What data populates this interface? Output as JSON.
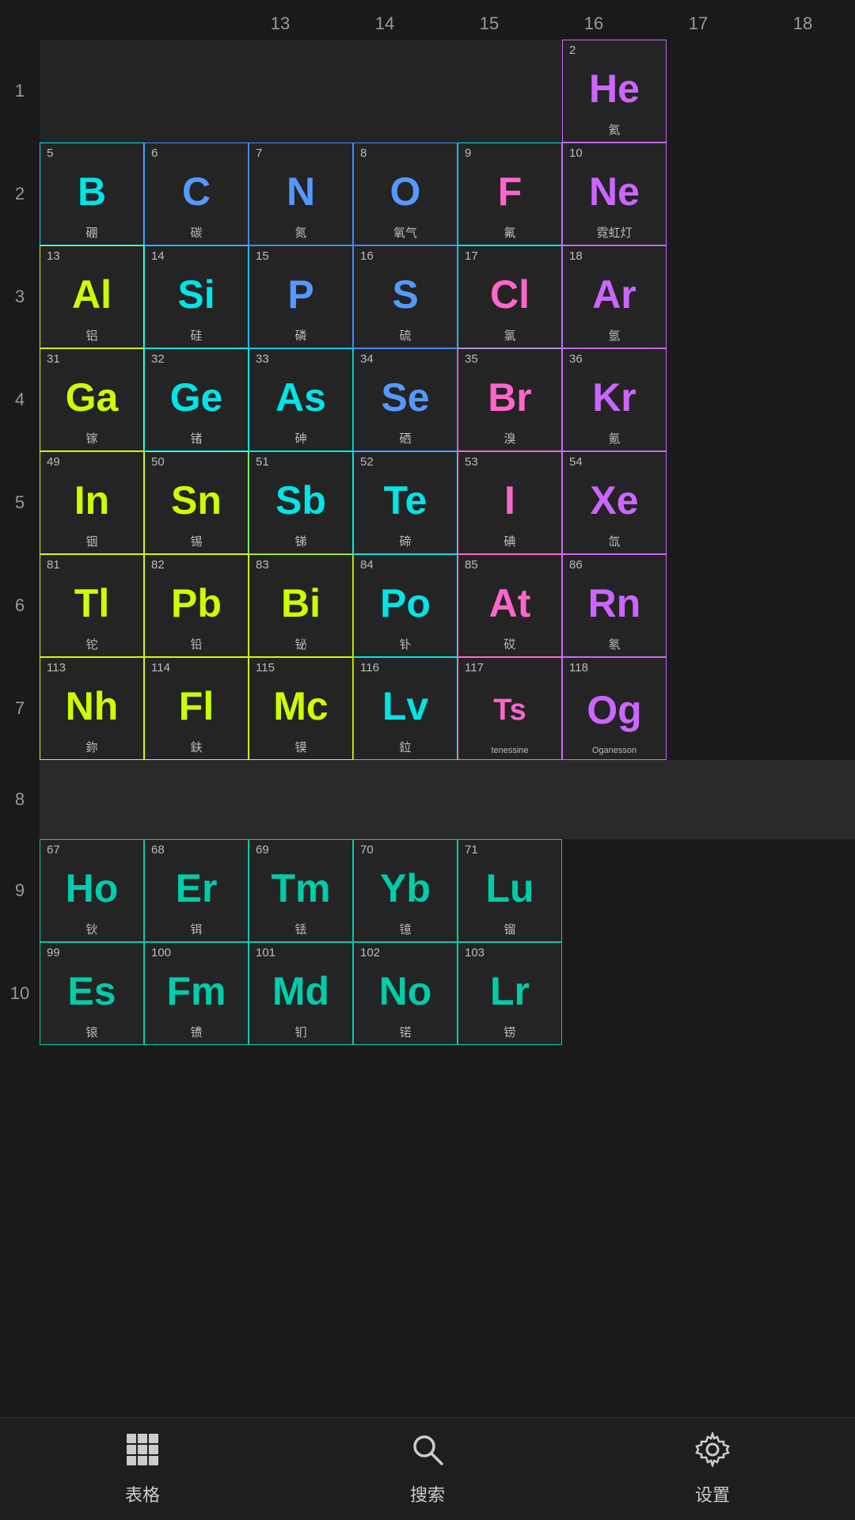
{
  "colHeaders": [
    "13",
    "14",
    "15",
    "16",
    "17",
    "18"
  ],
  "rowLabels": [
    "1",
    "2",
    "3",
    "4",
    "5",
    "6",
    "7",
    "8",
    "9",
    "10"
  ],
  "rows": [
    {
      "rowNum": "1",
      "cells": [
        {
          "num": "",
          "sym": "",
          "name": "",
          "color": "",
          "border": "",
          "empty": true
        },
        {
          "num": "",
          "sym": "",
          "name": "",
          "color": "",
          "border": "",
          "empty": true
        },
        {
          "num": "",
          "sym": "",
          "name": "",
          "color": "",
          "border": "",
          "empty": true
        },
        {
          "num": "",
          "sym": "",
          "name": "",
          "color": "",
          "border": "",
          "empty": true
        },
        {
          "num": "",
          "sym": "",
          "name": "",
          "color": "",
          "border": "",
          "empty": true
        },
        {
          "num": "2",
          "sym": "He",
          "name": "氦",
          "color": "s-purple",
          "border": "b-purple",
          "empty": false
        }
      ]
    },
    {
      "rowNum": "2",
      "cells": [
        {
          "num": "5",
          "sym": "B",
          "name": "硼",
          "color": "s-cyan",
          "border": "b-cyan",
          "empty": false
        },
        {
          "num": "6",
          "sym": "C",
          "name": "碳",
          "color": "s-blue",
          "border": "b-blue",
          "empty": false
        },
        {
          "num": "7",
          "sym": "N",
          "name": "氮",
          "color": "s-blue",
          "border": "b-blue",
          "empty": false
        },
        {
          "num": "8",
          "sym": "O",
          "name": "氧气",
          "color": "s-blue",
          "border": "b-blue",
          "empty": false
        },
        {
          "num": "9",
          "sym": "F",
          "name": "氟",
          "color": "s-pink",
          "border": "b-cyan",
          "empty": false
        },
        {
          "num": "10",
          "sym": "Ne",
          "name": "霓虹灯",
          "color": "s-purple",
          "border": "b-purple",
          "empty": false
        }
      ]
    },
    {
      "rowNum": "3",
      "cells": [
        {
          "num": "13",
          "sym": "Al",
          "name": "铝",
          "color": "s-green-y",
          "border": "b-green-y",
          "empty": false
        },
        {
          "num": "14",
          "sym": "Si",
          "name": "硅",
          "color": "s-cyan",
          "border": "b-cyan",
          "empty": false
        },
        {
          "num": "15",
          "sym": "P",
          "name": "磷",
          "color": "s-blue",
          "border": "b-blue",
          "empty": false
        },
        {
          "num": "16",
          "sym": "S",
          "name": "硫",
          "color": "s-blue",
          "border": "b-blue",
          "empty": false
        },
        {
          "num": "17",
          "sym": "Cl",
          "name": "氯",
          "color": "s-pink",
          "border": "b-cyan",
          "empty": false
        },
        {
          "num": "18",
          "sym": "Ar",
          "name": "氩",
          "color": "s-purple",
          "border": "b-purple",
          "empty": false
        }
      ]
    },
    {
      "rowNum": "4",
      "cells": [
        {
          "num": "31",
          "sym": "Ga",
          "name": "镓",
          "color": "s-green-y",
          "border": "b-green-y",
          "empty": false
        },
        {
          "num": "32",
          "sym": "Ge",
          "name": "锗",
          "color": "s-cyan",
          "border": "b-cyan",
          "empty": false
        },
        {
          "num": "33",
          "sym": "As",
          "name": "砷",
          "color": "s-cyan",
          "border": "b-cyan",
          "empty": false
        },
        {
          "num": "34",
          "sym": "Se",
          "name": "硒",
          "color": "s-blue",
          "border": "b-blue",
          "empty": false
        },
        {
          "num": "35",
          "sym": "Br",
          "name": "溴",
          "color": "s-pink",
          "border": "b-pink",
          "empty": false
        },
        {
          "num": "36",
          "sym": "Kr",
          "name": "氪",
          "color": "s-purple",
          "border": "b-purple",
          "empty": false
        }
      ]
    },
    {
      "rowNum": "5",
      "cells": [
        {
          "num": "49",
          "sym": "In",
          "name": "铟",
          "color": "s-green-y",
          "border": "b-green-y",
          "empty": false
        },
        {
          "num": "50",
          "sym": "Sn",
          "name": "锡",
          "color": "s-green-y",
          "border": "b-green-y",
          "empty": false
        },
        {
          "num": "51",
          "sym": "Sb",
          "name": "锑",
          "color": "s-cyan",
          "border": "b-cyan",
          "empty": false
        },
        {
          "num": "52",
          "sym": "Te",
          "name": "碲",
          "color": "s-cyan",
          "border": "b-cyan",
          "empty": false
        },
        {
          "num": "53",
          "sym": "I",
          "name": "碘",
          "color": "s-pink",
          "border": "b-pink",
          "empty": false
        },
        {
          "num": "54",
          "sym": "Xe",
          "name": "氙",
          "color": "s-purple",
          "border": "b-purple",
          "empty": false
        }
      ]
    },
    {
      "rowNum": "6",
      "cells": [
        {
          "num": "81",
          "sym": "Tl",
          "name": "铊",
          "color": "s-green-y",
          "border": "b-green-y",
          "empty": false
        },
        {
          "num": "82",
          "sym": "Pb",
          "name": "铅",
          "color": "s-green-y",
          "border": "b-green-y",
          "empty": false
        },
        {
          "num": "83",
          "sym": "Bi",
          "name": "铋",
          "color": "s-green-y",
          "border": "b-green-y",
          "empty": false
        },
        {
          "num": "84",
          "sym": "Po",
          "name": "钋",
          "color": "s-cyan",
          "border": "b-cyan",
          "empty": false
        },
        {
          "num": "85",
          "sym": "At",
          "name": "砹",
          "color": "s-pink",
          "border": "b-pink",
          "empty": false
        },
        {
          "num": "86",
          "sym": "Rn",
          "name": "氡",
          "color": "s-purple",
          "border": "b-purple",
          "empty": false
        }
      ]
    },
    {
      "rowNum": "7",
      "cells": [
        {
          "num": "113",
          "sym": "Nh",
          "name": "鉨",
          "color": "s-green-y",
          "border": "b-green-y",
          "empty": false
        },
        {
          "num": "114",
          "sym": "Fl",
          "name": "鈇",
          "color": "s-green-y",
          "border": "b-green-y",
          "empty": false
        },
        {
          "num": "115",
          "sym": "Mc",
          "name": "镆",
          "color": "s-green-y",
          "border": "b-green-y",
          "empty": false
        },
        {
          "num": "116",
          "sym": "Lv",
          "name": "鉝",
          "color": "s-cyan",
          "border": "b-cyan",
          "empty": false
        },
        {
          "num": "117",
          "sym": "Ts",
          "name": "tenessine",
          "color": "s-pink",
          "border": "b-pink",
          "empty": false
        },
        {
          "num": "118",
          "sym": "Og",
          "name": "Oganesson",
          "color": "s-purple",
          "border": "b-purple",
          "empty": false
        }
      ]
    }
  ],
  "lanthanideRow": {
    "rowNum": "9",
    "cells": [
      {
        "num": "67",
        "sym": "Ho",
        "name": "钬",
        "color": "s-teal",
        "border": "b-teal",
        "empty": false
      },
      {
        "num": "68",
        "sym": "Er",
        "name": "铒",
        "color": "s-teal",
        "border": "b-teal",
        "empty": false
      },
      {
        "num": "69",
        "sym": "Tm",
        "name": "铥",
        "color": "s-teal",
        "border": "b-teal",
        "empty": false
      },
      {
        "num": "70",
        "sym": "Yb",
        "name": "镱",
        "color": "s-teal",
        "border": "b-teal",
        "empty": false
      },
      {
        "num": "71",
        "sym": "Lu",
        "name": "镏",
        "color": "s-teal",
        "border": "b-teal",
        "empty": false
      }
    ]
  },
  "actinideRow": {
    "rowNum": "10",
    "cells": [
      {
        "num": "99",
        "sym": "Es",
        "name": "锿",
        "color": "s-teal",
        "border": "b-teal",
        "empty": false
      },
      {
        "num": "100",
        "sym": "Fm",
        "name": "镄",
        "color": "s-teal",
        "border": "b-teal",
        "empty": false
      },
      {
        "num": "101",
        "sym": "Md",
        "name": "钔",
        "color": "s-teal",
        "border": "b-teal",
        "empty": false
      },
      {
        "num": "102",
        "sym": "No",
        "name": "锘",
        "color": "s-teal",
        "border": "b-teal",
        "empty": false
      },
      {
        "num": "103",
        "sym": "Lr",
        "name": "铹",
        "color": "s-teal",
        "border": "b-teal",
        "empty": false
      }
    ]
  },
  "nav": {
    "table": "表格",
    "search": "搜索",
    "settings": "设置"
  }
}
